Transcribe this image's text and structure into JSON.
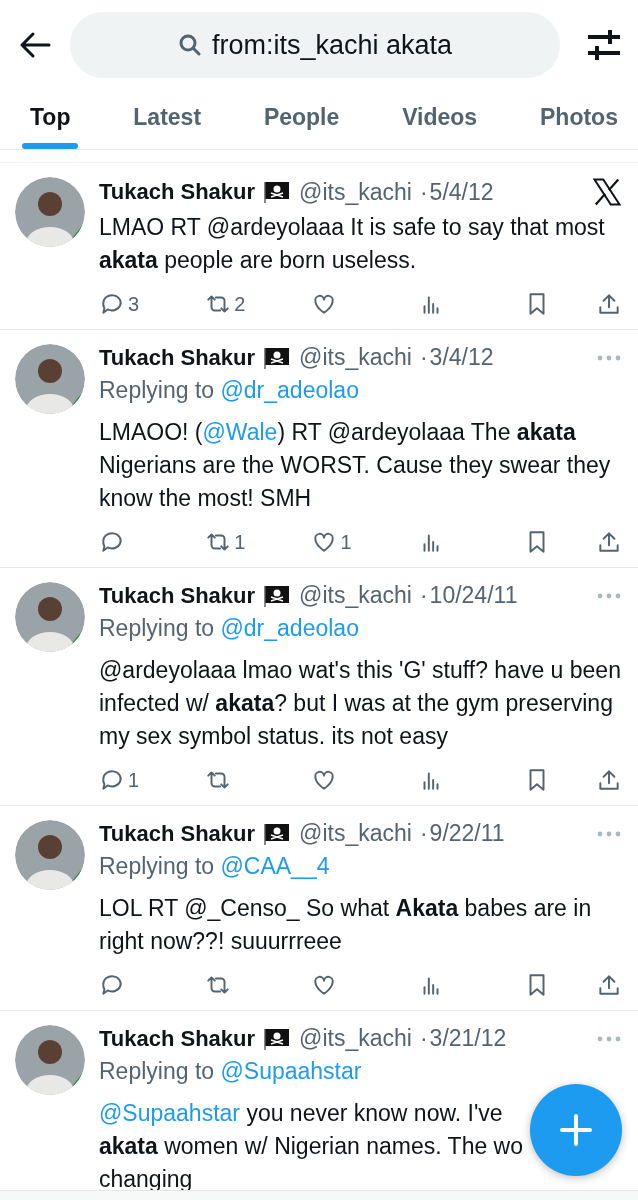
{
  "search": {
    "value": "from:its_kachi akata"
  },
  "tabs": [
    {
      "label": "Top",
      "selected": true
    },
    {
      "label": "Latest",
      "selected": false
    },
    {
      "label": "People",
      "selected": false
    },
    {
      "label": "Videos",
      "selected": false
    },
    {
      "label": "Photos",
      "selected": false
    }
  ],
  "tweets": [
    {
      "name": "Tukach Shakur",
      "handle": "@its_kachi",
      "dot": "·",
      "date": "5/4/12",
      "corner": {
        "kind": "x-logo"
      },
      "body": [
        {
          "kind": "plain",
          "text": "LMAO RT @ardeyolaaa It is safe to say that most "
        },
        {
          "kind": "bold",
          "text": "akata"
        },
        {
          "kind": "plain",
          "text": " people are born useless."
        }
      ],
      "replies": "3",
      "reposts": "2"
    },
    {
      "name": "Tukach Shakur",
      "handle": "@its_kachi",
      "dot": "·",
      "date": "3/4/12",
      "corner": {
        "kind": "more"
      },
      "replying_label": "Replying to",
      "replying_to": "@dr_adeolao",
      "body": [
        {
          "kind": "plain",
          "text": "LMAOO! ("
        },
        {
          "kind": "mention",
          "text": "@Wale"
        },
        {
          "kind": "plain",
          "text": ") RT @ardeyolaaa The "
        },
        {
          "kind": "bold",
          "text": "akata"
        },
        {
          "kind": "plain",
          "text": " Nigerians are the WORST. Cause they swear they know the most! SMH"
        }
      ],
      "reposts": "1",
      "likes": "1"
    },
    {
      "name": "Tukach Shakur",
      "handle": "@its_kachi",
      "dot": "·",
      "date": "10/24/11",
      "corner": {
        "kind": "more"
      },
      "replying_label": "Replying to",
      "replying_to": "@dr_adeolao",
      "body": [
        {
          "kind": "plain",
          "text": "@ardeyolaaa lmao wat's this 'G' stuff? have u been infected w/ "
        },
        {
          "kind": "bold",
          "text": "akata"
        },
        {
          "kind": "plain",
          "text": "? but I was at the gym preserving my sex symbol status. its not easy"
        }
      ],
      "replies": "1"
    },
    {
      "name": "Tukach Shakur",
      "handle": "@its_kachi",
      "dot": "·",
      "date": "9/22/11",
      "corner": {
        "kind": "more"
      },
      "replying_label": "Replying to",
      "replying_to": "@CAA__4",
      "body": [
        {
          "kind": "plain",
          "text": "LOL RT @_Censo_ So what "
        },
        {
          "kind": "bold",
          "text": "Akata"
        },
        {
          "kind": "plain",
          "text": " babes are in right now??! suuurrreee"
        }
      ]
    },
    {
      "name": "Tukach Shakur",
      "handle": "@its_kachi",
      "dot": "·",
      "date": "3/21/12",
      "corner": {
        "kind": "more"
      },
      "replying_label": "Replying to",
      "replying_to": "@Supaahstar",
      "body": [
        {
          "kind": "mention",
          "text": "@Supaahstar"
        },
        {
          "kind": "plain",
          "text": " you never know now. I've"
        },
        {
          "kind": "break"
        },
        {
          "kind": "bold",
          "text": "akata"
        },
        {
          "kind": "plain",
          "text": " women w/ Nigerian names. The wo"
        },
        {
          "kind": "break"
        },
        {
          "kind": "plain",
          "text": "changing"
        }
      ],
      "actions": false
    }
  ]
}
